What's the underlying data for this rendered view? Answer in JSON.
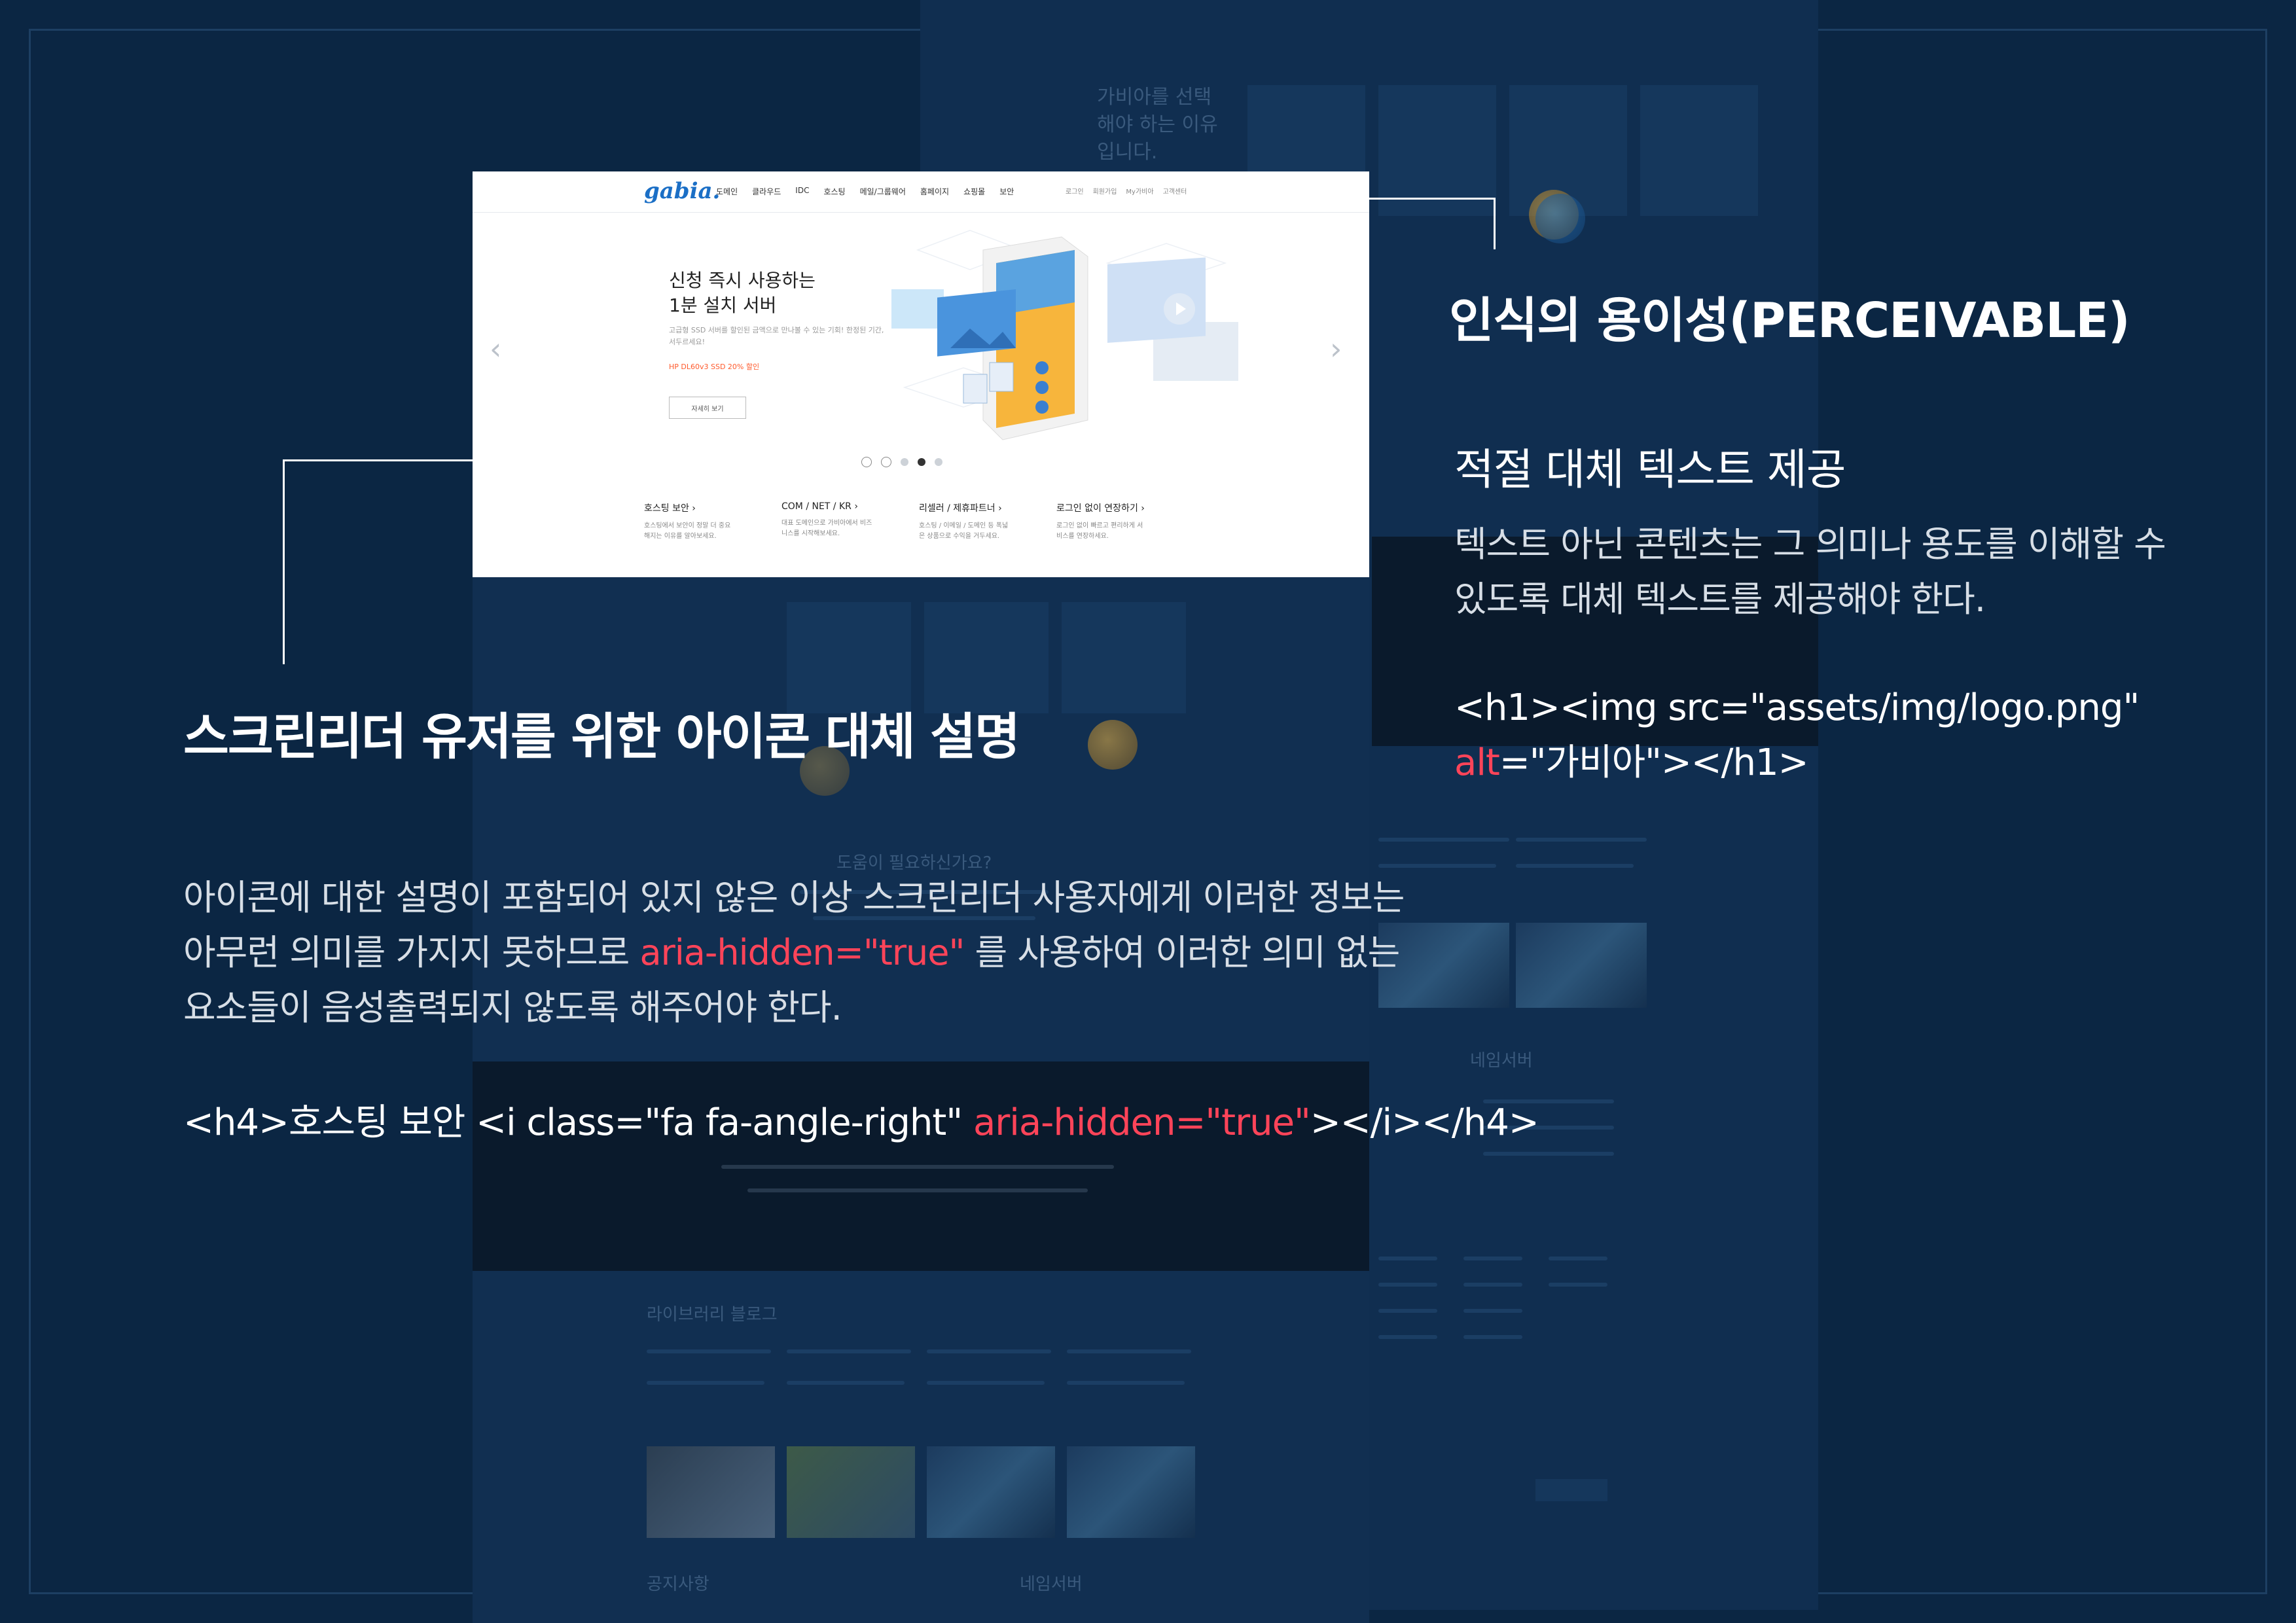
{
  "screenshot": {
    "logo_text": "gabia.",
    "nav": [
      "도메인",
      "클라우드",
      "IDC",
      "호스팅",
      "메일/그룹웨어",
      "홈페이지",
      "쇼핑몰",
      "보안"
    ],
    "util_links": [
      "로그인",
      "회원가입",
      "My가비아",
      "고객센터"
    ],
    "hero": {
      "title": "신청 즉시 사용하는\n1분 설치 서버",
      "description": "고급형 SSD 서버를 할인된 금액으로 만나볼 수 있는 기회! 한정된 기간, 서두르세요!",
      "promo": "HP DL60v3 SSD 20% 할인",
      "button": "자세히 보기"
    },
    "prev_icon": "chevron-left-icon",
    "next_icon": "chevron-right-icon",
    "features": [
      {
        "title": "호스팅 보안 ›",
        "desc": "호스팅에서 보안이 정말 더 중요해지는 이유를 알아보세요."
      },
      {
        "title": "COM / NET / KR ›",
        "desc": "대표 도메인으로 가비아에서 비즈니스를 시작해보세요."
      },
      {
        "title": "리셀러 / 제휴파트너 ›",
        "desc": "호스팅 / 이메일 / 도메인 등 폭넓은 상품으로 수익을 거두세요."
      },
      {
        "title": "로그인 없이 연장하기 ›",
        "desc": "로그인 없이 빠르고 편리하게 서비스를 연장하세요."
      }
    ]
  },
  "background": {
    "why_text": "가비아를 선택해야 하는 이유입니다.",
    "help_text": "도움이 필요하신가요?",
    "blog_text": "라이브러리 블로그",
    "notice_text": "공지사항",
    "nameserver_text": "네임서버"
  },
  "left_annotation": {
    "heading": "스크린리더 유저를 위한 아이콘 대체 설명",
    "body_1": "아이콘에 대한 설명이 포함되어 있지 않은 이상 스크린리더 사용자에게 이러한 정보는 아무런 의미를 가지지 못하므로 ",
    "body_accent": "aria-hidden=\"true\"",
    "body_2": " 를 사용하여 이러한 의미 없는 요소들이 음성출력되지 않도록 해주어야 한다.",
    "code_1": "<h4>호스팅 보안 <i class=\"fa fa-angle-right\" ",
    "code_accent": "aria-hidden=\"true\"",
    "code_2": "></i></h4>"
  },
  "right_annotation": {
    "title": "인식의 용이성(PERCEIVABLE)",
    "subtitle": "적절 대체 텍스트 제공",
    "body": "텍스트 아닌 콘텐츠는 그 의미나 용도를 이해할 수 있도록 대체 텍스트를 제공해야 한다.",
    "code_1": "<h1><img src=\"assets/img/logo.png\" ",
    "code_accent": "alt",
    "code_2": "=\"가비아\"></h1>"
  },
  "colors": {
    "background": "#0b2643",
    "accent": "#ff4459",
    "brand": "#1b6fc6"
  }
}
